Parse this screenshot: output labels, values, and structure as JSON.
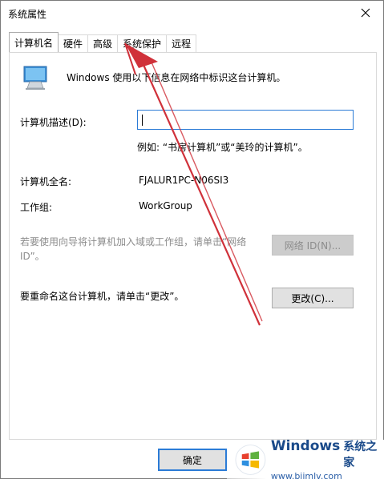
{
  "window": {
    "title": "系统属性"
  },
  "tabs": [
    {
      "label": "计算机名",
      "active": true
    },
    {
      "label": "硬件",
      "active": false
    },
    {
      "label": "高级",
      "active": false
    },
    {
      "label": "系统保护",
      "active": false
    },
    {
      "label": "远程",
      "active": false
    }
  ],
  "panel": {
    "description": "Windows 使用以下信息在网络中标识这台计算机。",
    "computer_description_label": "计算机描述(D):",
    "computer_description_value": "",
    "example": "例如: “书房计算机”或“美玲的计算机”。",
    "full_name_label": "计算机全名:",
    "full_name_value": "FJALUR1PC-N06SI3",
    "workgroup_label": "工作组:",
    "workgroup_value": "WorkGroup",
    "network_info": "若要使用向导将计算机加入域或工作组，请单击“网络 ID”。",
    "network_id_button": "网络 ID(N)...",
    "rename_info": "要重命名这台计算机，请单击“更改”。",
    "change_button": "更改(C)..."
  },
  "footer": {
    "ok_button": "确定"
  },
  "watermark": {
    "brand": "Windows",
    "cn": "系统之家",
    "url": "www.bjjmlv.com"
  },
  "colors": {
    "accent": "#2b7bd6",
    "arrow": "#d0313a"
  }
}
